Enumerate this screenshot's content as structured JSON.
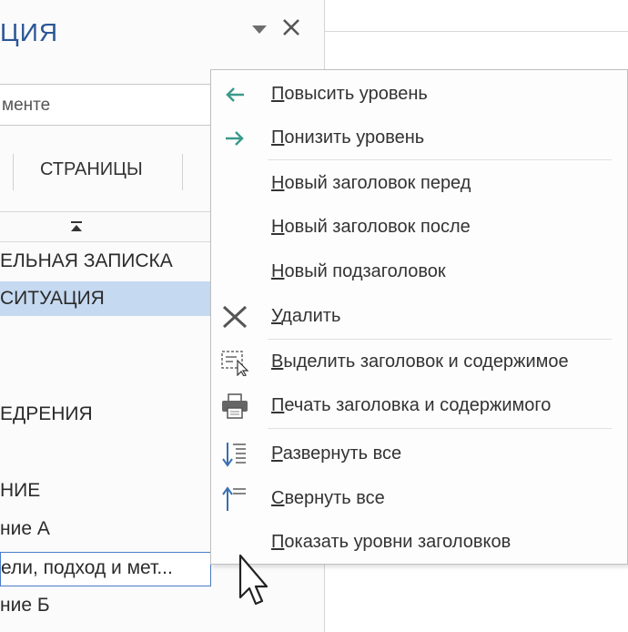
{
  "nav_pane": {
    "title": "ЦИЯ",
    "search_value": "менте",
    "tab_pages": "СТРАНИЦЫ",
    "headings": [
      {
        "text": "ЕЛЬНАЯ ЗАПИСКА",
        "state": "normal"
      },
      {
        "text": " СИТУАЦИЯ",
        "state": "selected"
      },
      {
        "text": "ЕДРЕНИЯ",
        "state": "normal"
      },
      {
        "text": "НИЕ",
        "state": "normal"
      },
      {
        "text": "ние А",
        "state": "normal"
      },
      {
        "text": "ели, подход и мет...",
        "state": "editing"
      },
      {
        "text": "ние Б",
        "state": "normal"
      }
    ]
  },
  "context_menu": {
    "items": [
      {
        "label": "Повысить уровень",
        "icon": "arrow-left-icon"
      },
      {
        "label": "Понизить уровень",
        "icon": "arrow-right-icon"
      },
      {
        "label": "Новый заголовок перед",
        "icon": "none"
      },
      {
        "label": "Новый заголовок после",
        "icon": "none"
      },
      {
        "label": "Новый подзаголовок",
        "icon": "none"
      },
      {
        "label": "Удалить",
        "icon": "delete-x-icon"
      },
      {
        "label": "Выделить заголовок и содержимое",
        "icon": "select-content-icon"
      },
      {
        "label": "Печать заголовка и содержимого",
        "icon": "printer-icon"
      },
      {
        "label": "Развернуть все",
        "icon": "expand-all-icon"
      },
      {
        "label": "Свернуть все",
        "icon": "collapse-all-icon"
      },
      {
        "label": "Показать уровни заголовков",
        "icon": "none"
      }
    ]
  },
  "colors": {
    "title_blue": "#2b5797",
    "arrow_teal": "#3a9a8a",
    "selection_blue": "#c5d9f1",
    "edit_border": "#4a7cc7"
  }
}
